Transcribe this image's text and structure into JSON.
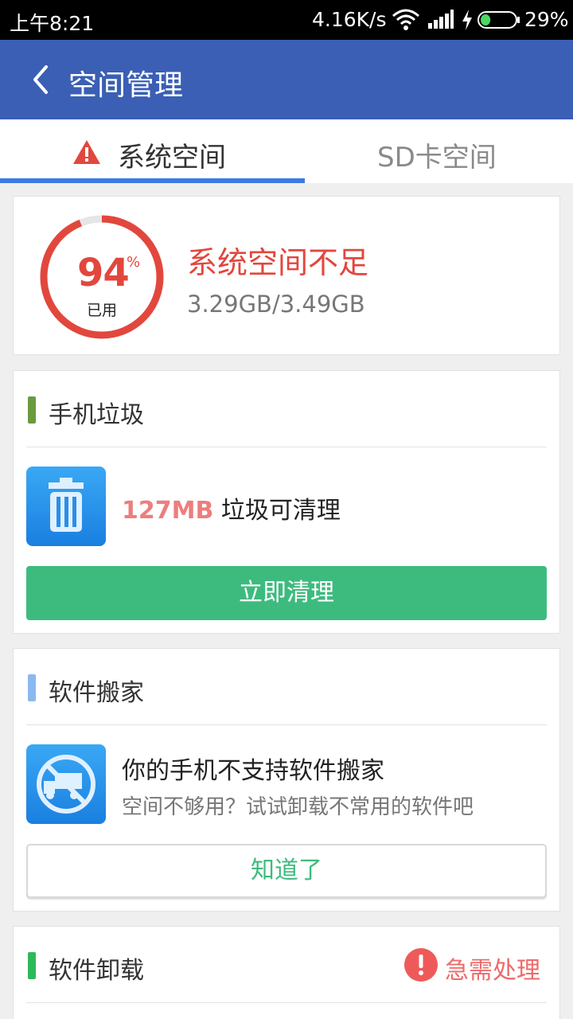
{
  "status_bar": {
    "time": "上午8:21",
    "net_speed": "4.16K/s",
    "battery_percent": "29%",
    "battery_level": 0.29
  },
  "app_bar": {
    "title": "空间管理"
  },
  "tabs": [
    {
      "label": "系统空间",
      "active": true
    },
    {
      "label": "SD卡空间",
      "active": false
    }
  ],
  "usage": {
    "percent_value": "94",
    "percent_sign": "%",
    "used_label": "已用",
    "fraction_used": 0.94,
    "status_title": "系统空间不足",
    "size_text": "3.29GB/3.49GB"
  },
  "junk": {
    "section_title": "手机垃圾",
    "amount": "127MB",
    "amount_suffix": " 垃圾可清理",
    "button_label": "立即清理"
  },
  "app_move": {
    "section_title": "软件搬家",
    "message": "你的手机不支持软件搬家",
    "hint": "空间不够用？试试卸载不常用的软件吧",
    "button_label": "知道了"
  },
  "uninstall": {
    "section_title": "软件卸载",
    "badge_text": "急需处理"
  },
  "colors": {
    "primary": "#3a5fb4",
    "alert_red": "#e2473d",
    "green": "#3dbb7e",
    "tab_indicator": "#3a7ce0",
    "section_junk": "#6b9a3f",
    "section_move": "#8ab8f0",
    "section_uninstall": "#2eb85c"
  }
}
